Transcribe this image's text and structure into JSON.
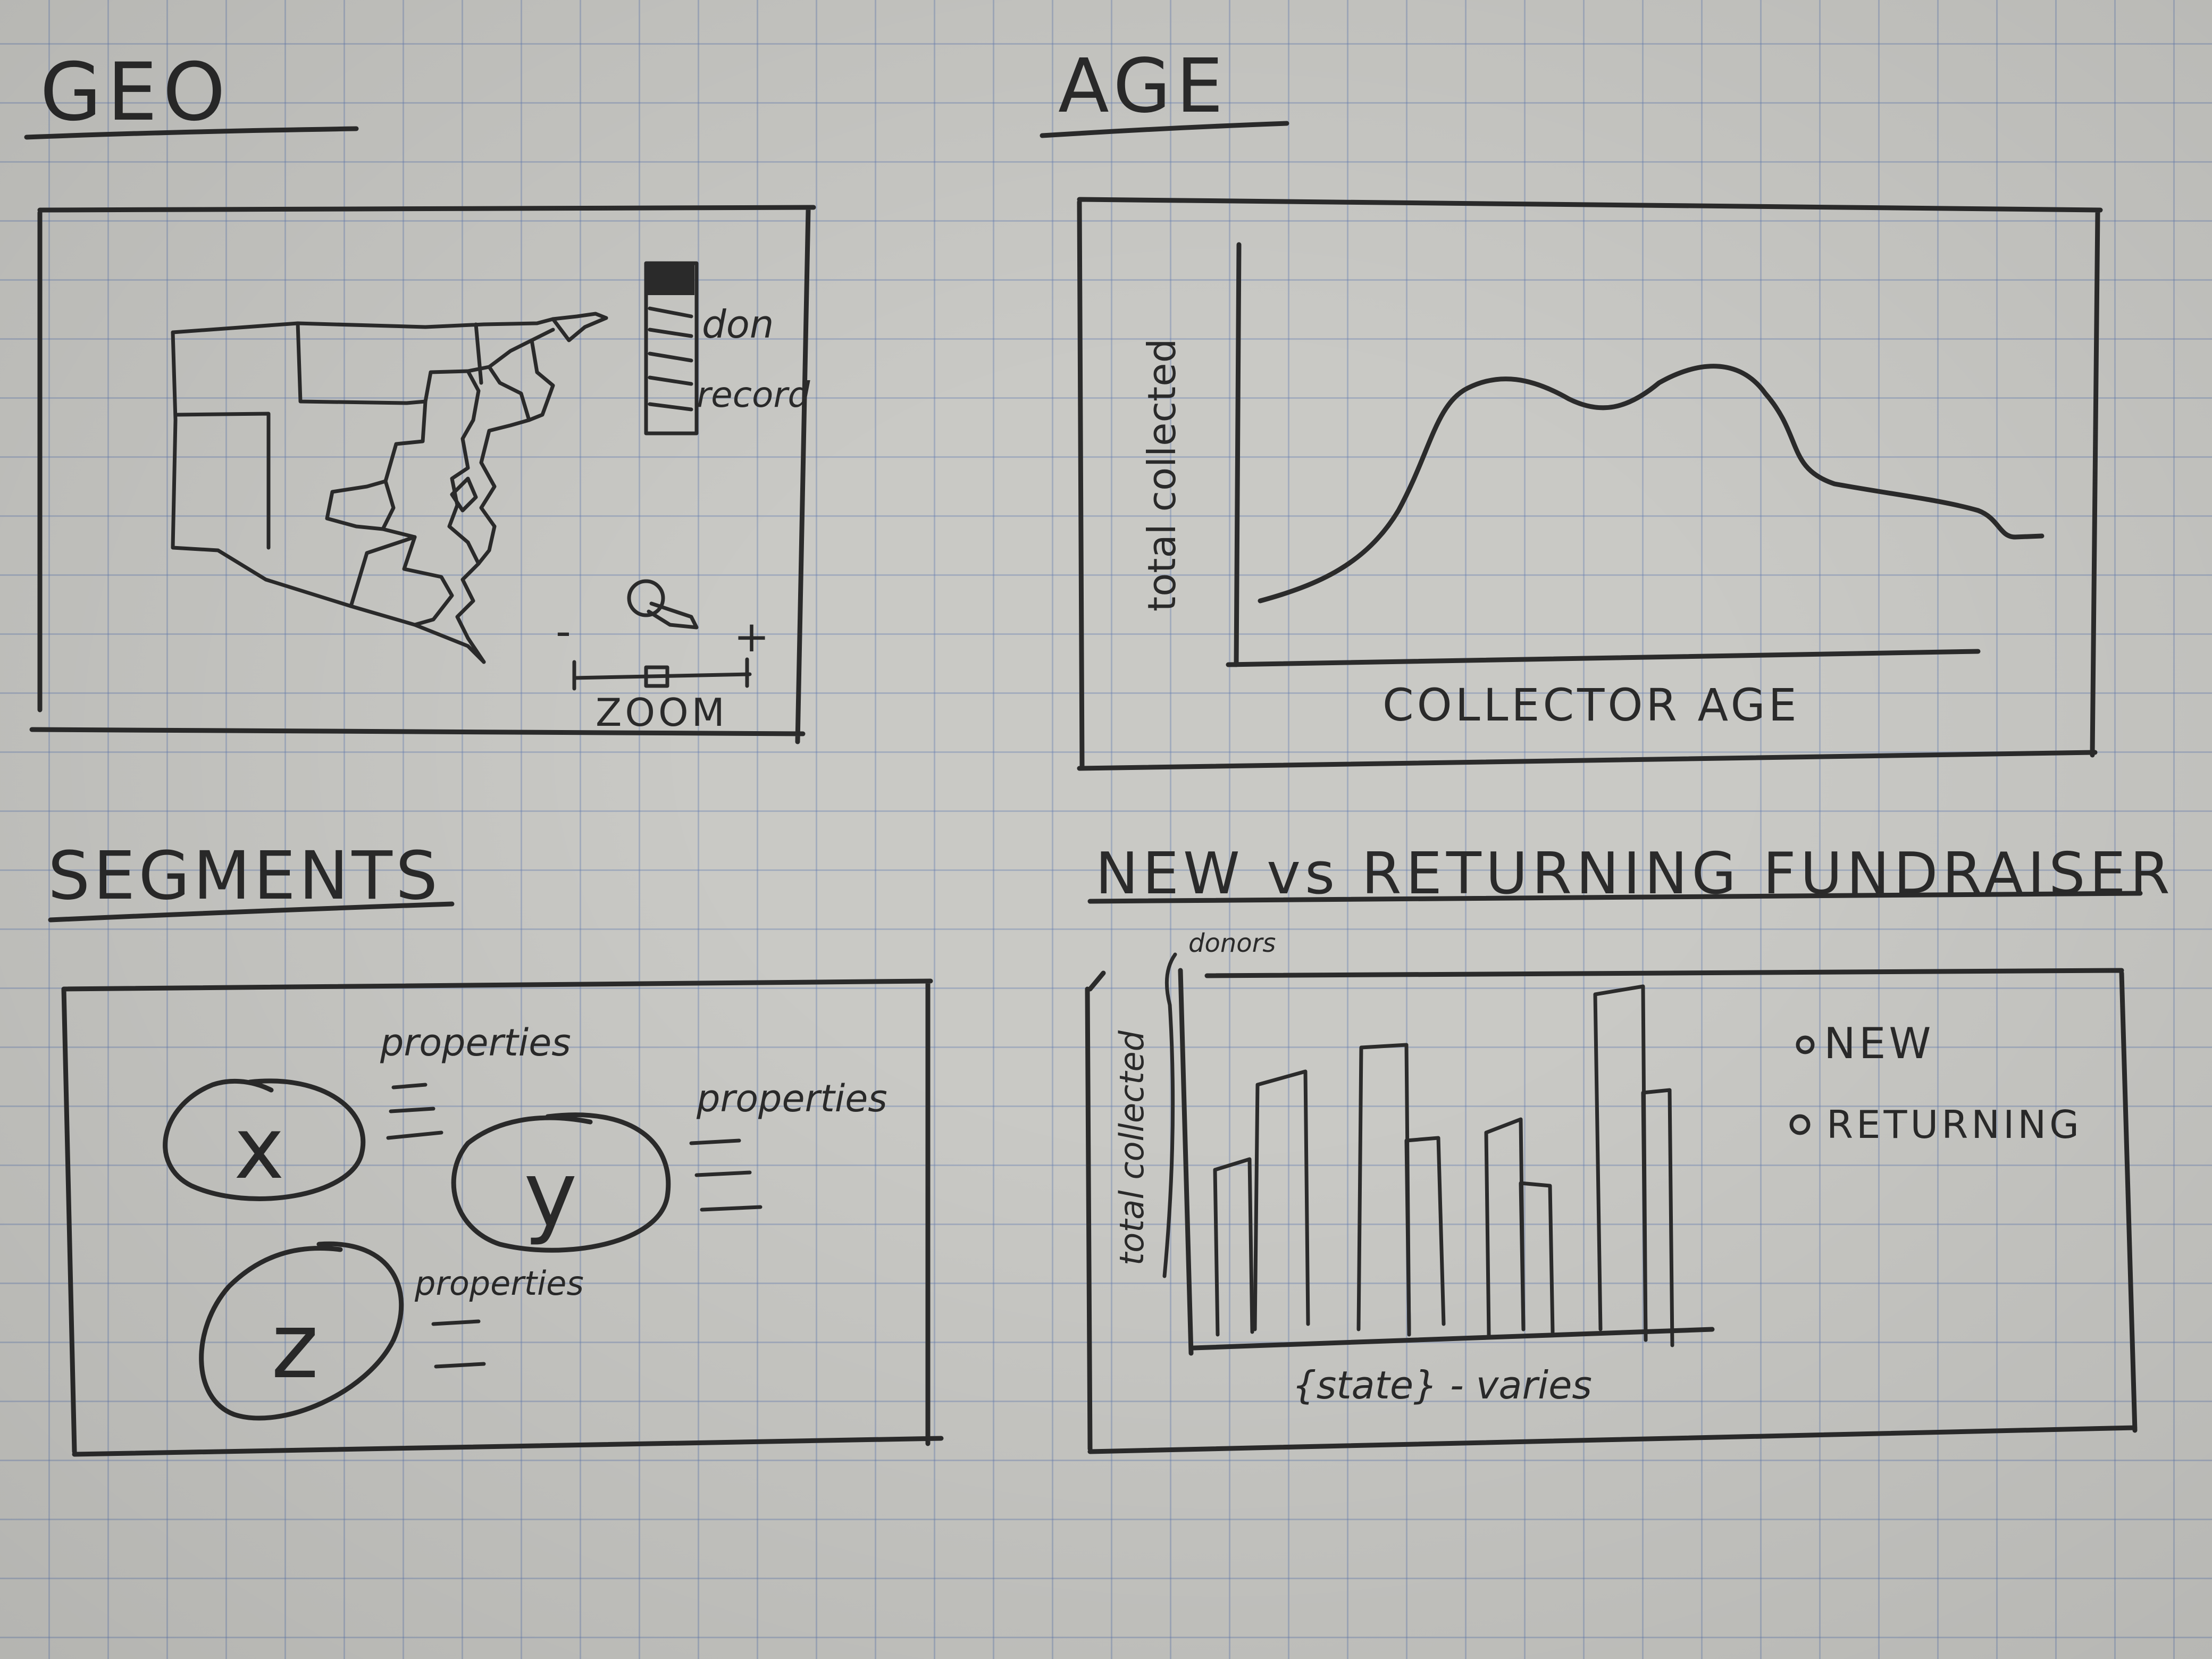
{
  "panels": {
    "geo": {
      "title": "GEO",
      "legend_label_1": "don",
      "legend_label_2": "record",
      "zoom_minus": "-",
      "zoom_plus": "+",
      "zoom_label": "ZOOM"
    },
    "age": {
      "title": "AGE",
      "ylabel": "total collected",
      "xlabel": "COLLECTOR AGE"
    },
    "segments": {
      "title": "SEGMENTS",
      "items": [
        {
          "letter": "x",
          "properties_label": "properties"
        },
        {
          "letter": "y",
          "properties_label": "properties"
        },
        {
          "letter": "z",
          "properties_label": "properties"
        }
      ]
    },
    "new_vs_returning": {
      "title": "NEW vs RETURNING FUNDRAISER",
      "ylabel": "total collected",
      "ylabel_note": "donors",
      "xlabel": "{state} - varies",
      "legend": [
        {
          "label": "NEW"
        },
        {
          "label": "RETURNING"
        }
      ]
    }
  },
  "ink_color": "#2b2b2b",
  "paper_color": "#c9c9c5",
  "grid_color": "#5f78af"
}
